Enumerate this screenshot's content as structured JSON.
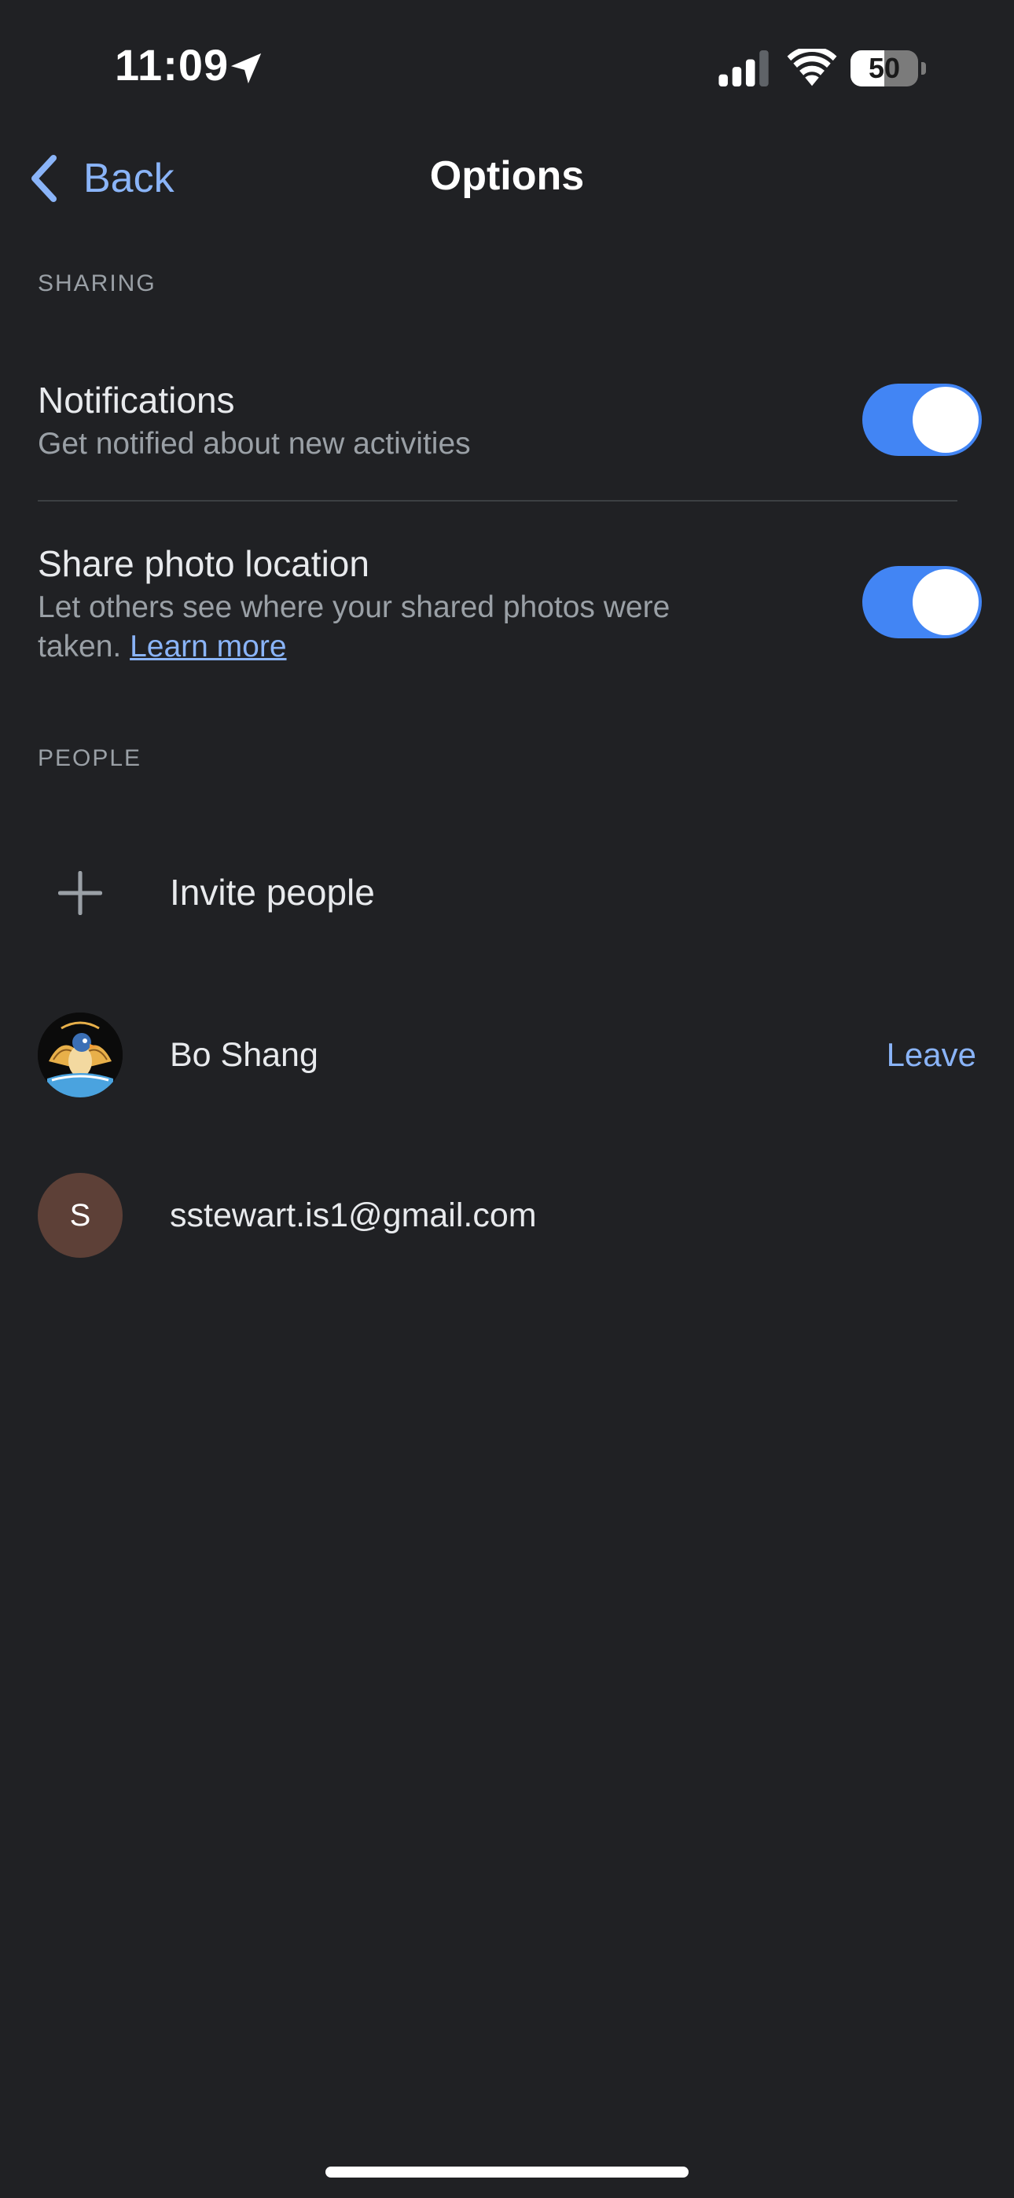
{
  "status_bar": {
    "time": "11:09",
    "battery_level": "50",
    "battery_fraction": 0.5
  },
  "nav": {
    "back_label": "Back",
    "title": "Options"
  },
  "sharing": {
    "header": "SHARING",
    "notifications": {
      "title": "Notifications",
      "subtitle": "Get notified about new activities",
      "enabled": true
    },
    "location": {
      "title": "Share photo location",
      "subtitle": "Let others see where your shared photos were taken.",
      "link": "Learn more",
      "enabled": true
    }
  },
  "people": {
    "header": "PEOPLE",
    "invite_label": "Invite people",
    "members": [
      {
        "name": "Bo Shang",
        "action": "Leave"
      },
      {
        "name": "sstewart.is1@gmail.com",
        "initial": "S"
      }
    ]
  },
  "colors": {
    "background": "#202124",
    "accent": "#8ab4f8",
    "toggle_on": "#4285f4",
    "avatar_initial_bg": "#5d4037"
  },
  "icons": {
    "back": "chevron-left-icon",
    "location": "location-arrow-icon",
    "signal": "cellular-signal-icon",
    "wifi": "wifi-icon",
    "battery": "battery-icon",
    "invite": "plus-icon"
  }
}
